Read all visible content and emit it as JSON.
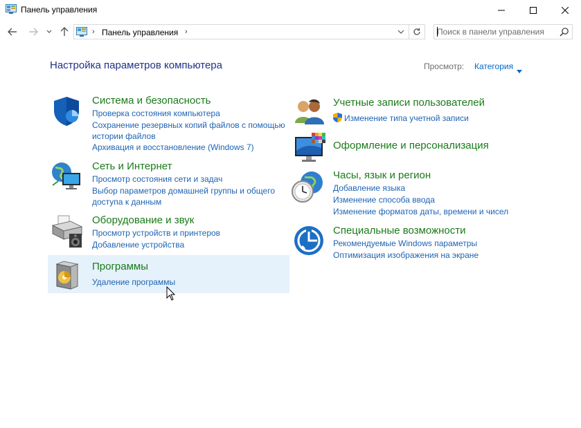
{
  "window": {
    "title": "Панель управления"
  },
  "address_bar": {
    "path": "Панель управления",
    "separator": "›"
  },
  "search": {
    "placeholder": "Поиск в панели управления"
  },
  "main": {
    "heading": "Настройка параметров компьютера",
    "view_label": "Просмотр:",
    "view_value": "Категория"
  },
  "categories": [
    {
      "title": "Система и безопасность",
      "icon": "shield-icon",
      "links": [
        "Проверка состояния компьютера",
        "Сохранение резервных копий файлов с помощью",
        "истории файлов",
        "Архивация и восстановление (Windows 7)"
      ]
    },
    {
      "title": "Сеть и Интернет",
      "icon": "network-icon",
      "links": [
        "Просмотр состояния сети и задач",
        "Выбор параметров домашней группы и общего",
        "доступа к данным"
      ]
    },
    {
      "title": "Оборудование и звук",
      "icon": "printer-icon",
      "links": [
        "Просмотр устройств и принтеров",
        "Добавление устройства"
      ]
    },
    {
      "title": "Программы",
      "icon": "programs-icon",
      "links": [
        "Удаление программы"
      ]
    },
    {
      "title": "Учетные записи пользователей",
      "icon": "users-icon",
      "links": [
        "Изменение типа учетной записи"
      ]
    },
    {
      "title": "Оформление и персонализация",
      "icon": "display-icon",
      "links": []
    },
    {
      "title": "Часы, язык и регион",
      "icon": "clock-globe-icon",
      "links": [
        "Добавление языка",
        "Изменение способа ввода",
        "Изменение форматов даты, времени и чисел"
      ]
    },
    {
      "title": "Специальные возможности",
      "icon": "accessibility-icon",
      "links": [
        "Рекомендуемые Windows параметры",
        "Оптимизация изображения на экране"
      ]
    }
  ],
  "colors": {
    "category_title": "#1a7a1a",
    "link": "#1e63b4",
    "heading": "#1e3287",
    "hover": "#e5f1fb"
  }
}
